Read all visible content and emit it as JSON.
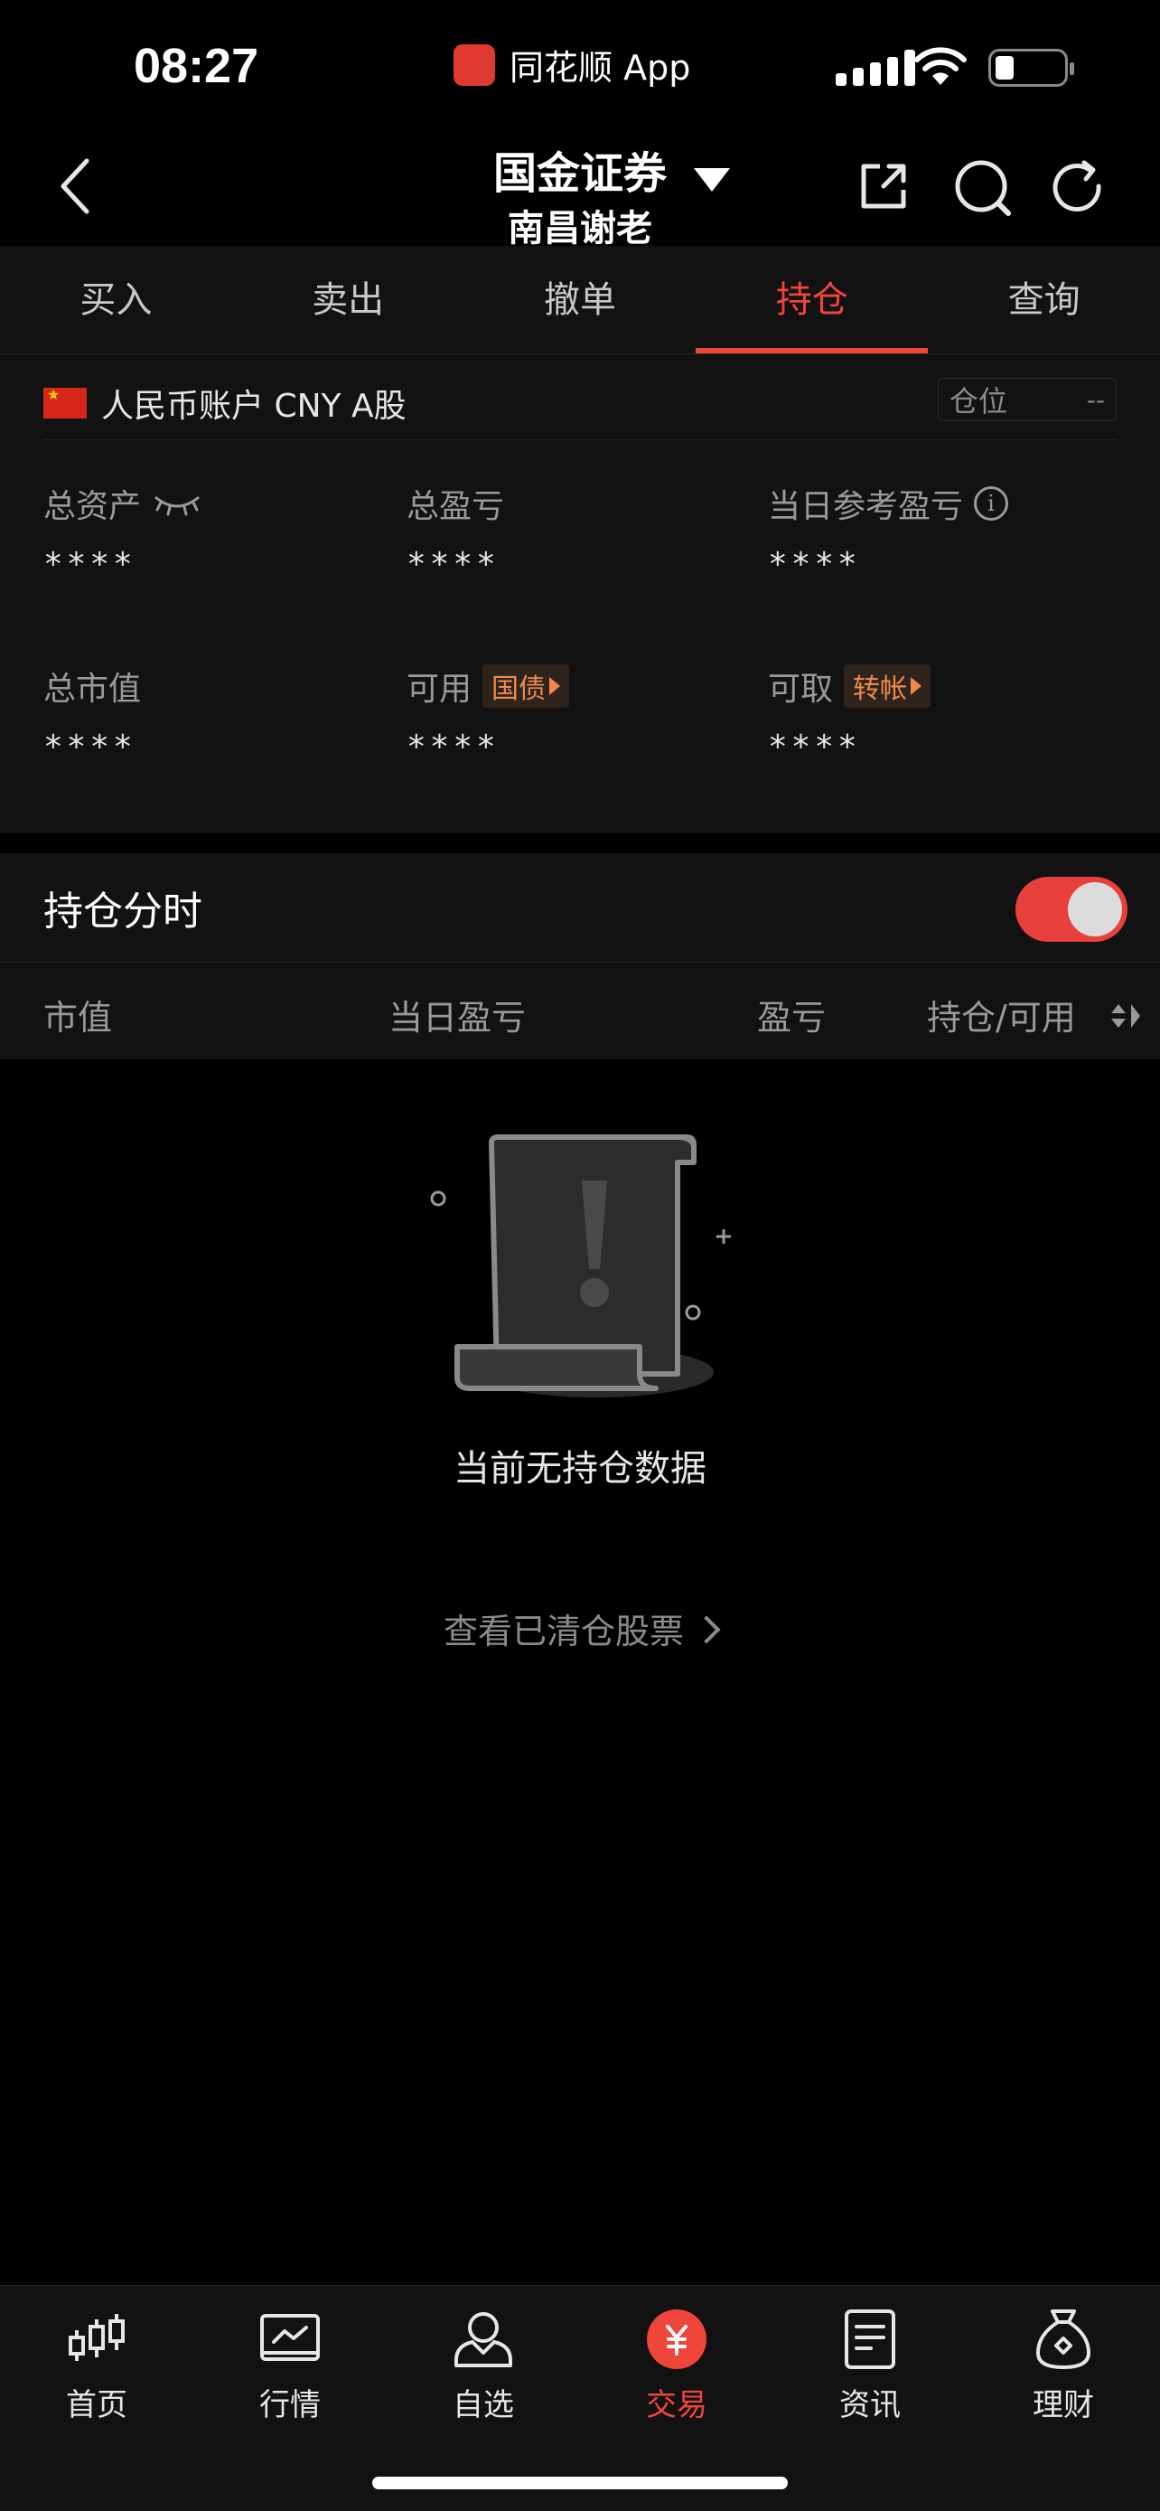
{
  "status_bar": {
    "time": "08:27",
    "app_name": "同花顺 App"
  },
  "header": {
    "title": "国金证券",
    "subtitle": "南昌谢老"
  },
  "tabs": [
    {
      "label": "买入"
    },
    {
      "label": "卖出"
    },
    {
      "label": "撤单"
    },
    {
      "label": "持仓",
      "active": true
    },
    {
      "label": "查询"
    }
  ],
  "account": {
    "name": "人民币账户 CNY A股",
    "position_label": "仓位",
    "position_value": "--",
    "metrics": {
      "total_assets": {
        "label": "总资产",
        "value": "****"
      },
      "total_pnl": {
        "label": "总盈亏",
        "value": "****"
      },
      "daily_ref_pnl": {
        "label": "当日参考盈亏",
        "value": "****"
      },
      "total_market_value": {
        "label": "总市值",
        "value": "****"
      },
      "available": {
        "label": "可用",
        "tag": "国债",
        "value": "****"
      },
      "withdrawable": {
        "label": "可取",
        "tag": "转帐",
        "value": "****"
      }
    }
  },
  "holdings": {
    "title": "持仓分时",
    "toggle_on": true,
    "columns": {
      "market_value": "市值",
      "daily_pnl": "当日盈亏",
      "pnl": "盈亏",
      "holding_available": "持仓/可用"
    },
    "empty_text": "当前无持仓数据",
    "cleared_link": "查看已清仓股票"
  },
  "tabbar": [
    {
      "label": "首页",
      "icon": "candlestick-icon"
    },
    {
      "label": "行情",
      "icon": "chart-icon"
    },
    {
      "label": "自选",
      "icon": "user-icon"
    },
    {
      "label": "交易",
      "icon": "yuan-icon",
      "active": true
    },
    {
      "label": "资讯",
      "icon": "document-icon"
    },
    {
      "label": "理财",
      "icon": "money-bag-icon"
    }
  ],
  "colors": {
    "accent": "#f0453a",
    "tag": "#f08a4b",
    "background": "#000000",
    "panel": "#121212"
  }
}
